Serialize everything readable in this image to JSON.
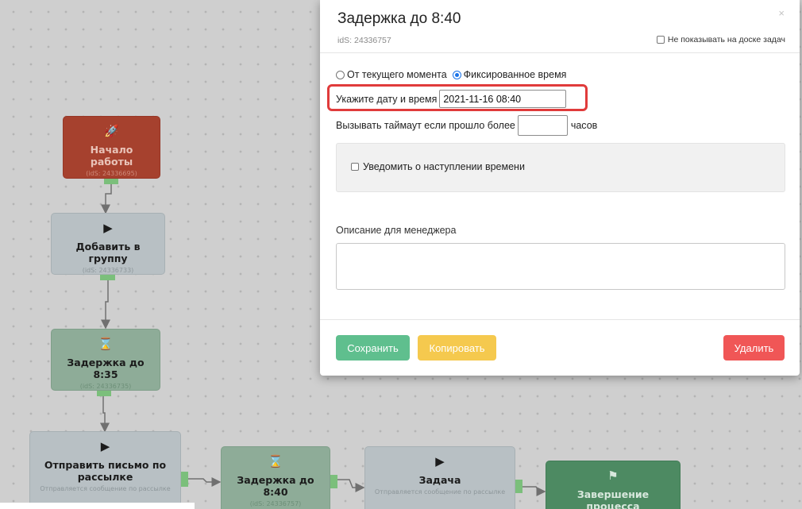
{
  "canvas": {
    "nodes": [
      {
        "icon": "rocket-icon",
        "glyph": "🚀",
        "title": "Начало работы",
        "ids": "(idS: 24336695)"
      },
      {
        "icon": "play-icon",
        "glyph": "▶",
        "title": "Добавить в группу",
        "ids": "(idS: 24336733)"
      },
      {
        "icon": "hourglass-icon",
        "glyph": "⌛",
        "title": "Задержка до 8:35",
        "ids": "(idS: 24336735)"
      },
      {
        "icon": "play-icon",
        "glyph": "▶",
        "title": "Отправить письмо по рассылке",
        "ids": "Отправляется сообщение по рассылке"
      },
      {
        "icon": "hourglass-icon",
        "glyph": "⌛",
        "title": "Задержка до 8:40",
        "ids": "(idS: 24336757)"
      },
      {
        "icon": "play-icon",
        "glyph": "▶",
        "title": "Задача",
        "ids": "Отправляется сообщение по рассылке"
      },
      {
        "icon": "flag-icon",
        "glyph": "⚑",
        "title": "Завершение процесса",
        "ids": ""
      }
    ]
  },
  "modal": {
    "title": "Задержка до 8:40",
    "close_glyph": "×",
    "ids": "idS: 24336757",
    "hide_on_board_label": "Не показывать на доске задач",
    "radio_from_now": "От текущего момента",
    "radio_fixed": "Фиксированное время",
    "selected_mode": "fixed",
    "date_label": "Укажите дату и время",
    "date_value": "2021-11-16 08:40",
    "timeout_prefix": "Вызывать таймаут если прошло более",
    "timeout_value": "",
    "timeout_suffix": "часов",
    "notify_label": "Уведомить о наступлении времени",
    "description_label": "Описание для менеджера",
    "description_value": "",
    "save_label": "Сохранить",
    "copy_label": "Копировать",
    "delete_label": "Удалить"
  },
  "colors": {
    "accent_highlight": "#e03b3b",
    "save": "#5fbf8e",
    "copy": "#f5c94e",
    "delete": "#f05656",
    "start_node": "#a6412e",
    "action_node": "#b8c0c4",
    "delay_node": "#8eac98",
    "end_node": "#4d8a62"
  }
}
